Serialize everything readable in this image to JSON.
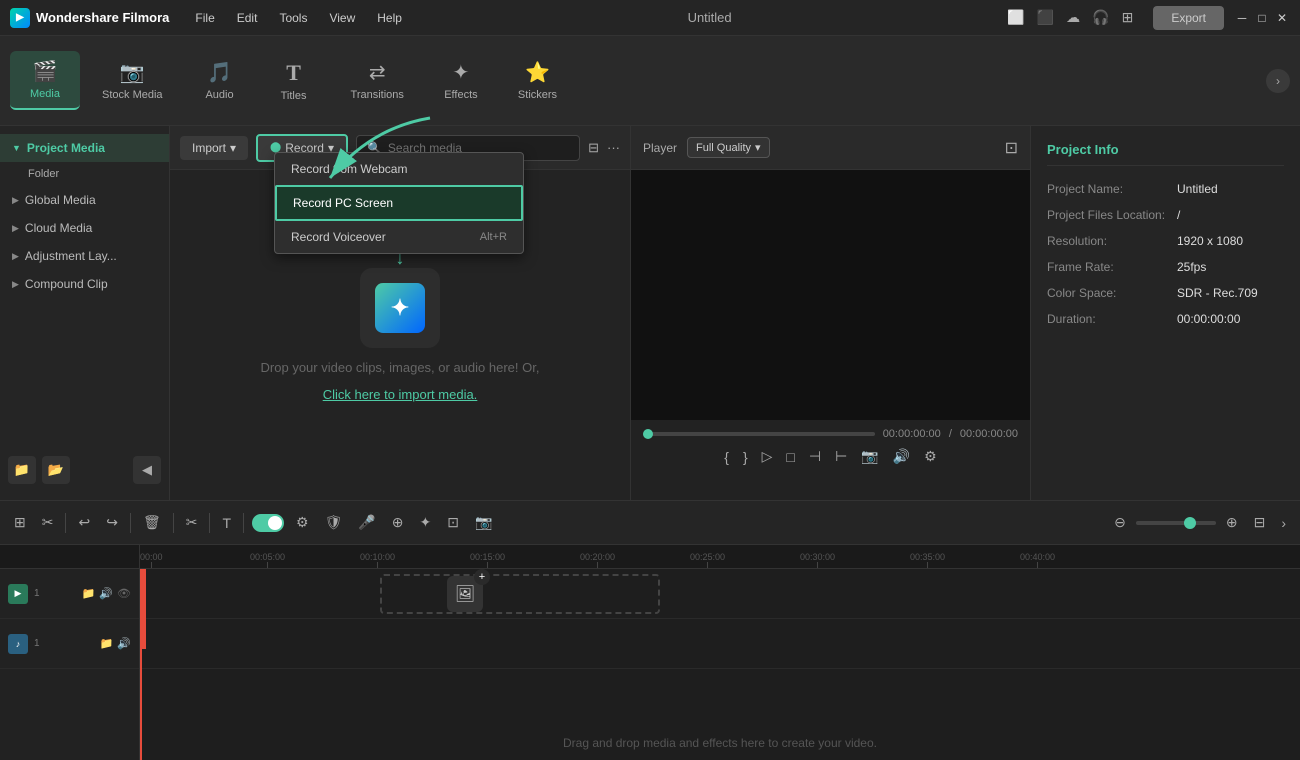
{
  "app": {
    "name": "Wondershare Filmora",
    "title": "Untitled"
  },
  "titlebar": {
    "menu": [
      "File",
      "Edit",
      "Tools",
      "View",
      "Help"
    ],
    "export_label": "Export",
    "window_controls": [
      "─",
      "□",
      "✕"
    ]
  },
  "toolbar": {
    "items": [
      {
        "id": "media",
        "label": "Media",
        "icon": "🎬",
        "active": true
      },
      {
        "id": "stock-media",
        "label": "Stock Media",
        "icon": "📷"
      },
      {
        "id": "audio",
        "label": "Audio",
        "icon": "🎵"
      },
      {
        "id": "titles",
        "label": "Titles",
        "icon": "T"
      },
      {
        "id": "transitions",
        "label": "Transitions",
        "icon": "↔"
      },
      {
        "id": "effects",
        "label": "Effects",
        "icon": "✦"
      },
      {
        "id": "stickers",
        "label": "Stickers",
        "icon": "⭐"
      }
    ]
  },
  "sidebar": {
    "items": [
      {
        "id": "project-media",
        "label": "Project Media",
        "active": true
      },
      {
        "id": "folder",
        "label": "Folder"
      },
      {
        "id": "global-media",
        "label": "Global Media"
      },
      {
        "id": "cloud-media",
        "label": "Cloud Media"
      },
      {
        "id": "adjustment-layer",
        "label": "Adjustment Lay..."
      },
      {
        "id": "compound-clip",
        "label": "Compound Clip"
      }
    ],
    "bottom_icons": [
      "📁",
      "📂"
    ]
  },
  "media_toolbar": {
    "import_label": "Import",
    "record_label": "Record",
    "search_placeholder": "Search media"
  },
  "record_dropdown": {
    "items": [
      {
        "id": "from-webcam",
        "label": "Record from Webcam",
        "shortcut": "",
        "highlighted": false
      },
      {
        "id": "pc-screen",
        "label": "Record PC Screen",
        "shortcut": "",
        "highlighted": true
      },
      {
        "id": "voiceover",
        "label": "Record Voiceover",
        "shortcut": "Alt+R",
        "highlighted": false
      }
    ]
  },
  "drop_zone": {
    "text": "Drop your video clips, images, or audio here! Or,",
    "link": "Click here to import media."
  },
  "player": {
    "label": "Player",
    "quality": "Full Quality",
    "time_current": "00:00:00:00",
    "time_total": "00:00:00:00",
    "time_separator": "/"
  },
  "project_info": {
    "panel_title": "Project Info",
    "fields": [
      {
        "label": "Project Name:",
        "value": "Untitled"
      },
      {
        "label": "Project Files Location:",
        "value": "/"
      },
      {
        "label": "Resolution:",
        "value": "1920 x 1080"
      },
      {
        "label": "Frame Rate:",
        "value": "25fps"
      },
      {
        "label": "Color Space:",
        "value": "SDR - Rec.709"
      },
      {
        "label": "Duration:",
        "value": "00:00:00:00"
      }
    ]
  },
  "timeline": {
    "ruler_marks": [
      "00:00",
      "00:05:00",
      "00:10:00",
      "00:15:00",
      "00:20:00",
      "00:25:00",
      "00:30:00",
      "00:35:00",
      "00:40:00"
    ],
    "drag_drop_text": "Drag and drop media and effects here to create your video.",
    "track1_label": "1",
    "track2_label": "1"
  }
}
